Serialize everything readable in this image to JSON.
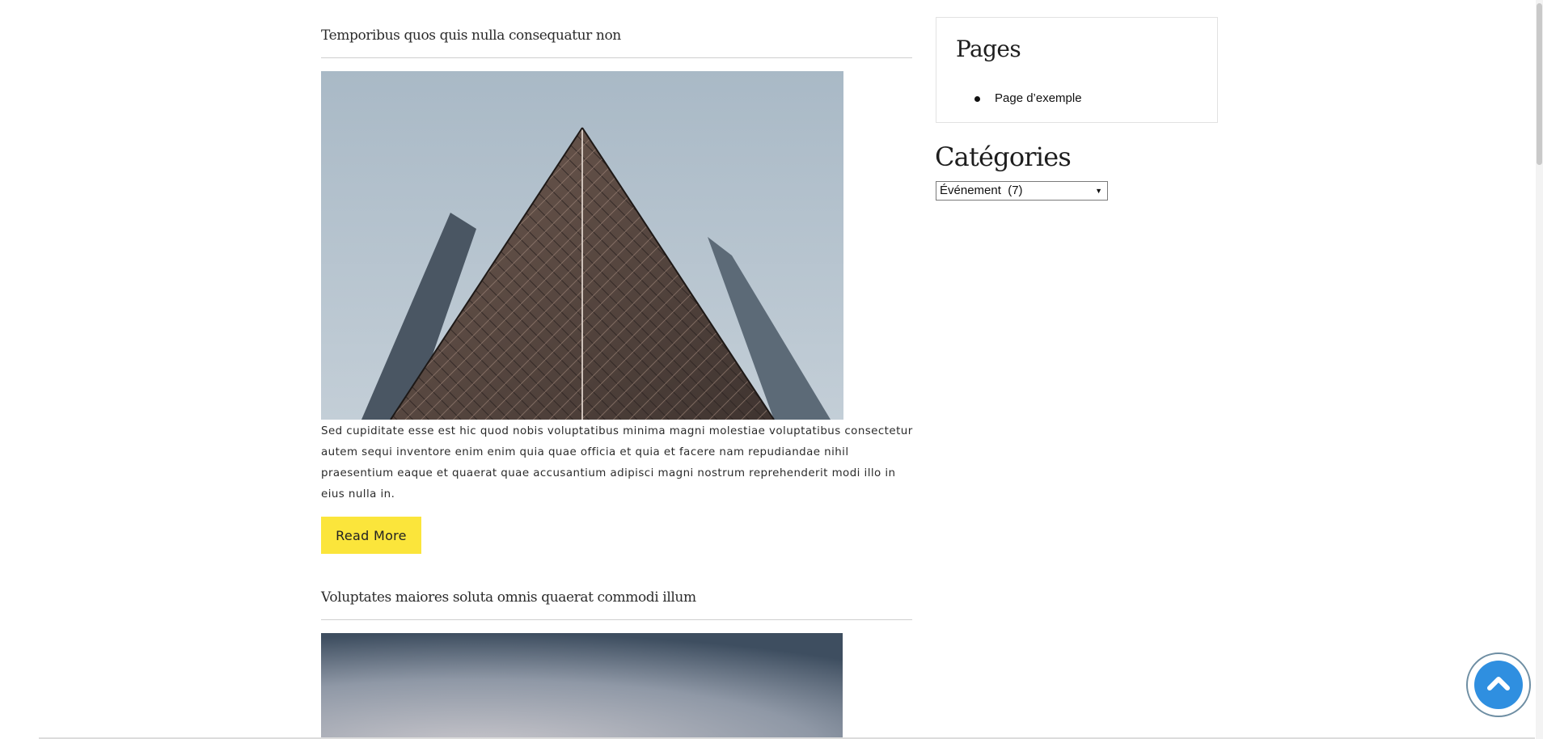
{
  "posts": [
    {
      "title": "Temporibus quos quis nulla consequatur non",
      "image_icon": "building-photo",
      "excerpt": "Sed cupiditate esse est hic quod nobis voluptatibus minima magni molestiae voluptatibus consectetur autem sequi inventore enim enim quia quae officia et quia et facere nam repudiandae nihil praesentium eaque et quaerat quae accusantium adipisci magni nostrum reprehenderit modi illo in eius nulla in.",
      "read_more_label": "Read More"
    },
    {
      "title": "Voluptates maiores soluta omnis quaerat commodi illum",
      "image_icon": "sky-photo"
    }
  ],
  "sidebar": {
    "pages": {
      "title": "Pages",
      "items": [
        {
          "label": "Page d’exemple"
        }
      ]
    },
    "categories": {
      "title": "Catégories",
      "selected": "Événement  (7)",
      "caret": "▼"
    }
  },
  "scroll_top": {
    "icon": "chevron-up-icon"
  },
  "colors": {
    "accent": "#fbe53b",
    "scroll_button": "#2f8fe0"
  }
}
